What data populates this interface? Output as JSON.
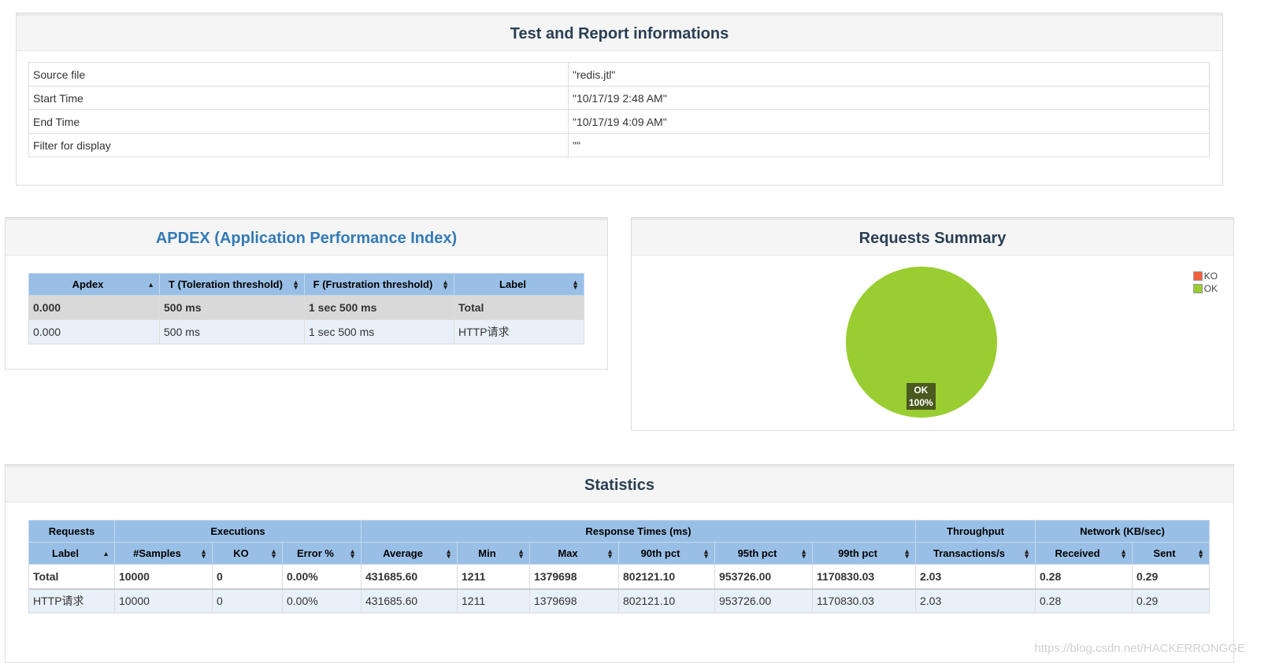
{
  "info": {
    "title": "Test and Report informations",
    "rows": [
      {
        "key": "Source file",
        "value": "\"redis.jtl\""
      },
      {
        "key": "Start Time",
        "value": "\"10/17/19 2:48 AM\""
      },
      {
        "key": "End Time",
        "value": "\"10/17/19 4:09 AM\""
      },
      {
        "key": "Filter for display",
        "value": "\"\""
      }
    ]
  },
  "apdex": {
    "title": "APDEX (Application Performance Index)",
    "headers": [
      "Apdex",
      "T (Toleration threshold)",
      "F (Frustration threshold)",
      "Label"
    ],
    "total": [
      "0.000",
      "500 ms",
      "1 sec 500 ms",
      "Total"
    ],
    "row": [
      "0.000",
      "500 ms",
      "1 sec 500 ms",
      "HTTP请求"
    ]
  },
  "summary": {
    "title": "Requests Summary",
    "legend": [
      {
        "label": "KO",
        "color": "#f0603c"
      },
      {
        "label": "OK",
        "color": "#9acd32"
      }
    ],
    "pie_label": "OK",
    "pie_pct": "100%"
  },
  "chart_data": {
    "type": "pie",
    "title": "Requests Summary",
    "categories": [
      "KO",
      "OK"
    ],
    "values": [
      0,
      100
    ],
    "colors": [
      "#f0603c",
      "#9acd32"
    ],
    "legend_position": "top-right"
  },
  "stats": {
    "title": "Statistics",
    "groups": [
      "Requests",
      "Executions",
      "Response Times (ms)",
      "Throughput",
      "Network (KB/sec)"
    ],
    "headers": [
      "Label",
      "#Samples",
      "KO",
      "Error %",
      "Average",
      "Min",
      "Max",
      "90th pct",
      "95th pct",
      "99th pct",
      "Transactions/s",
      "Received",
      "Sent"
    ],
    "total": [
      "Total",
      "10000",
      "0",
      "0.00%",
      "431685.60",
      "1211",
      "1379698",
      "802121.10",
      "953726.00",
      "1170830.03",
      "2.03",
      "0.28",
      "0.29"
    ],
    "row": [
      "HTTP请求",
      "10000",
      "0",
      "0.00%",
      "431685.60",
      "1211",
      "1379698",
      "802121.10",
      "953726.00",
      "1170830.03",
      "2.03",
      "0.28",
      "0.29"
    ]
  },
  "watermark": "https://blog.csdn.net/HACKERRONGGE"
}
